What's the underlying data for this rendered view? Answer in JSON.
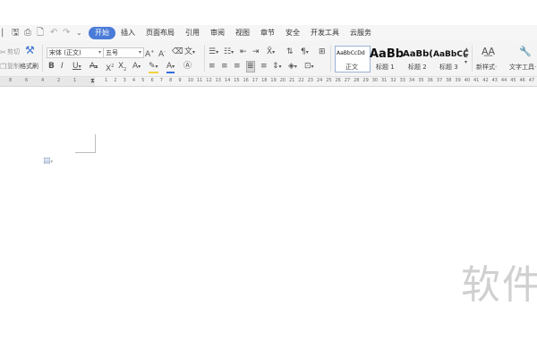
{
  "menu": {
    "tabs": [
      {
        "label": "开始",
        "active": true
      },
      {
        "label": "插入"
      },
      {
        "label": "页面布局"
      },
      {
        "label": "引用"
      },
      {
        "label": "审阅"
      },
      {
        "label": "视图"
      },
      {
        "label": "章节"
      },
      {
        "label": "安全"
      },
      {
        "label": "开发工具"
      },
      {
        "label": "云服务"
      }
    ]
  },
  "ribbon": {
    "cut_label": "剪切",
    "copy_label": "复制",
    "format_painter_label": "格式刷",
    "font_family": "宋体 (正文)",
    "font_size": "五号",
    "styles": [
      {
        "sample": "AaBbCcDd",
        "label": "正文"
      },
      {
        "sample": "AaBb",
        "label": "标题 1"
      },
      {
        "sample": "AaBb(",
        "label": "标题 2"
      },
      {
        "sample": "AaBbC(",
        "label": "标题 3"
      }
    ],
    "new_style_label": "新样式·",
    "text_tools_label": "文字工具·"
  },
  "ruler": {
    "left_numbers": [
      "8",
      "6",
      "4",
      "2",
      "1"
    ],
    "right_numbers": [
      "1",
      "2",
      "3",
      "4",
      "5",
      "6",
      "7",
      "8",
      "9",
      "10",
      "11",
      "12",
      "13",
      "14",
      "15",
      "16",
      "17",
      "18",
      "19",
      "20",
      "21",
      "22",
      "23",
      "24",
      "25",
      "26",
      "27",
      "28",
      "29",
      "30",
      "31",
      "32",
      "33",
      "34",
      "35",
      "36",
      "37",
      "38",
      "39",
      "40",
      "41",
      "42",
      "43",
      "44",
      "45",
      "46",
      "47",
      "48"
    ]
  },
  "watermark": "软件",
  "colors": {
    "accent": "#4a7bd8",
    "font_color_bar": "#2d6cdf",
    "highlight": "#f3d23c"
  }
}
